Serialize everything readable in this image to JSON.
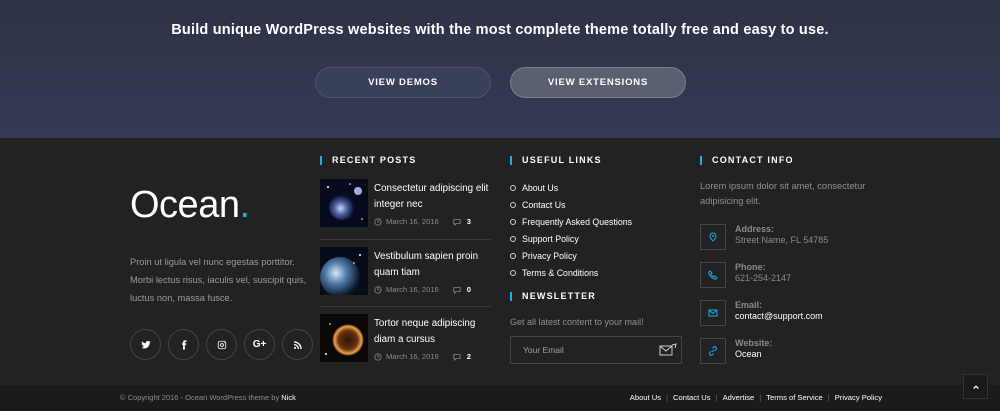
{
  "hero": {
    "title": "Build unique WordPress websites with the most complete theme totally free and easy to use.",
    "btn_demos": "VIEW DEMOS",
    "btn_extensions": "VIEW EXTENSIONS"
  },
  "brand": {
    "logo_text": "Ocean",
    "logo_dot": ".",
    "accent": "#13aff0",
    "about": "Proin ut ligula vel nunc egestas porttitor. Morbi lectus risus, iaculis vel, suscipit quis, luctus non, massa fusce."
  },
  "social": [
    {
      "icon": "twitter-icon"
    },
    {
      "icon": "facebook-icon"
    },
    {
      "icon": "instagram-icon"
    },
    {
      "icon": "google-plus-icon",
      "label": "G+"
    },
    {
      "icon": "rss-icon"
    }
  ],
  "recent_posts": {
    "title": "RECENT POSTS",
    "items": [
      {
        "title": "Consectetur adipiscing elit integer nec",
        "date": "March 16, 2016",
        "comments": "3"
      },
      {
        "title": "Vestibulum sapien proin quam tiam",
        "date": "March 16, 2016",
        "comments": "0"
      },
      {
        "title": "Tortor neque adipiscing diam a cursus",
        "date": "March 16, 2016",
        "comments": "2"
      }
    ]
  },
  "useful_links": {
    "title": "USEFUL LINKS",
    "items": [
      "About Us",
      "Contact Us",
      "Frequently Asked Questions",
      "Support Policy",
      "Privacy Policy",
      "Terms & Conditions"
    ]
  },
  "newsletter": {
    "title": "NEWSLETTER",
    "text": "Get all latest content to your mail!",
    "placeholder": "Your Email"
  },
  "contact": {
    "title": "CONTACT INFO",
    "text": "Lorem ipsum dolor sit amet, consectetur adipisicing elit.",
    "items": [
      {
        "label": "Address:",
        "value": "Street Name, FL 54785",
        "icon": "map-pin-icon"
      },
      {
        "label": "Phone:",
        "value": "621-254-2147",
        "icon": "phone-icon"
      },
      {
        "label": "Email:",
        "value": "contact@support.com",
        "icon": "envelope-icon"
      },
      {
        "label": "Website:",
        "value": "Ocean",
        "icon": "link-icon"
      }
    ]
  },
  "bottom": {
    "copyright": "© Copyright 2016 - Ocean WordPress theme by ",
    "author": "Nick",
    "links": [
      "About Us",
      "Contact Us",
      "Advertise",
      "Terms of Service",
      "Privacy Policy"
    ]
  }
}
